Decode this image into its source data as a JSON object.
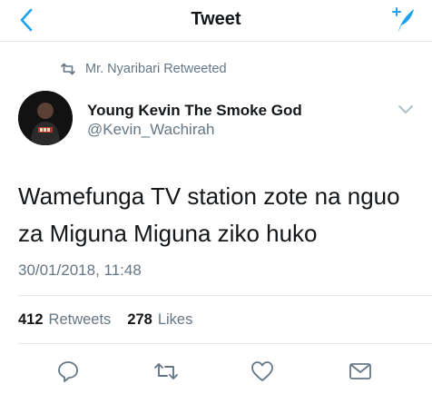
{
  "nav": {
    "title": "Tweet",
    "back_icon": "chevron-left-icon",
    "compose_icon": "compose-tweet-icon",
    "accent_color": "#1da1f2"
  },
  "retweet": {
    "icon": "retweet-icon",
    "text": "Mr. Nyaribari Retweeted"
  },
  "author": {
    "name": "Young Kevin The Smoke God",
    "handle": "@Kevin_Wachirah",
    "menu_icon": "chevron-down-icon"
  },
  "tweet": {
    "line1": "Wamefunga TV station zote na nguo",
    "line2": "za Miguna Miguna ziko huko",
    "timestamp": "30/01/2018, 11:48"
  },
  "stats": {
    "retweets_count": "412",
    "retweets_label": "Retweets",
    "likes_count": "278",
    "likes_label": "Likes"
  },
  "actions": [
    "reply-icon",
    "retweet-icon",
    "like-icon",
    "share-icon"
  ],
  "colors": {
    "text": "#14171a",
    "secondary": "#657786",
    "divider": "#e1e8ed"
  }
}
